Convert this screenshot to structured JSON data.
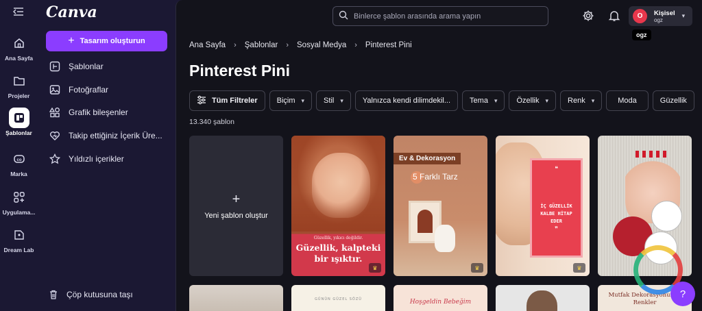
{
  "rail": {
    "items": [
      {
        "label": "Ana Sayfa"
      },
      {
        "label": "Projeler"
      },
      {
        "label": "Şablonlar"
      },
      {
        "label": "Marka"
      },
      {
        "label": "Uygulama..."
      },
      {
        "label": "Dream Lab"
      }
    ]
  },
  "sidebar": {
    "logo": "Canva",
    "create_label": "Tasarım oluşturun",
    "items": [
      {
        "label": "Şablonlar"
      },
      {
        "label": "Fotoğraflar"
      },
      {
        "label": "Grafik bileşenler"
      },
      {
        "label": "Takip ettiğiniz İçerik Üre..."
      },
      {
        "label": "Yıldızlı içerikler"
      }
    ],
    "trash_label": "Çöp kutusuna taşı"
  },
  "header": {
    "search_placeholder": "Binlerce şablon arasında arama yapın",
    "account_type": "Kişisel",
    "account_name": "ogz",
    "avatar_initial": "O",
    "tooltip": "ogz"
  },
  "breadcrumb": [
    "Ana Sayfa",
    "Şablonlar",
    "Sosyal Medya",
    "Pinterest Pini"
  ],
  "page": {
    "title": "Pinterest Pini",
    "count": "13.340 şablon"
  },
  "filters": {
    "all": "Tüm Filtreler",
    "chips": [
      "Biçim",
      "Stil",
      "Yalnızca kendi dilimdekil...",
      "Tema",
      "Özellik",
      "Renk",
      "Moda",
      "Güzellik"
    ]
  },
  "templates": {
    "new_label": "Yeni şablon oluştur",
    "t1_small": "Güzellik, yıkıcı değildir.",
    "t1_big": "Güzellik, kalpteki bir ışıktır.",
    "t2_tag": "Ev & Dekorasyon",
    "t2_sub": "5 Farklı Tarz",
    "t3_line2": "İÇ GÜZELLİK KALBE HİTAP EDER",
    "r2b_text": "GÜNÜN GÜZEL SÖZÜ",
    "r2c_text": "Hoşgeldin Bebeğim",
    "r2e_text": "Mutfak Dekorasyonunda Renkler"
  },
  "colors": {
    "accent": "#8b3dff",
    "background": "#1b1833",
    "main_bg": "#13131b",
    "avatar": "#e8374c"
  }
}
